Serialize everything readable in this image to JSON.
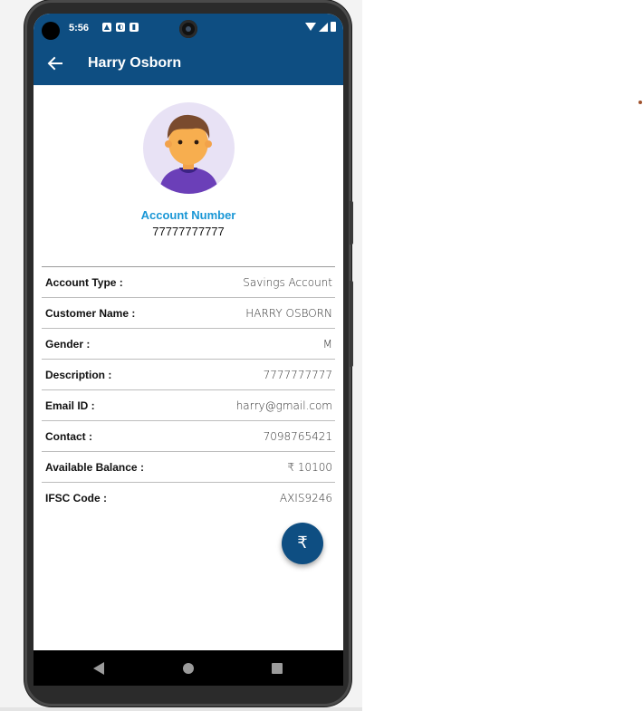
{
  "status_bar": {
    "time": "5:56",
    "icons": [
      "photo-icon",
      "app-icon",
      "sd-card-icon"
    ],
    "right_icons": [
      "wifi-icon",
      "signal-icon",
      "battery-icon"
    ]
  },
  "app_bar": {
    "title": "Harry Osborn",
    "back_icon": "arrow-left-icon"
  },
  "profile": {
    "account_label": "Account Number",
    "account_number": "77777777777"
  },
  "details": [
    {
      "label": "Account Type :",
      "value": "Savings Account"
    },
    {
      "label": "Customer Name :",
      "value": "HARRY OSBORN"
    },
    {
      "label": "Gender :",
      "value": "M"
    },
    {
      "label": "Description :",
      "value": "7777777777"
    },
    {
      "label": "Email ID :",
      "value": "harry@gmail.com"
    },
    {
      "label": "Contact :",
      "value": "7098765421"
    },
    {
      "label": "Available Balance :",
      "value": "₹ 10100"
    },
    {
      "label": "IFSC Code :",
      "value": "AXIS9246"
    }
  ],
  "fab": {
    "symbol": "₹"
  },
  "colors": {
    "primary": "#0e4e82",
    "accent": "#1a97d6",
    "avatar_bg": "#e8e2f5"
  }
}
